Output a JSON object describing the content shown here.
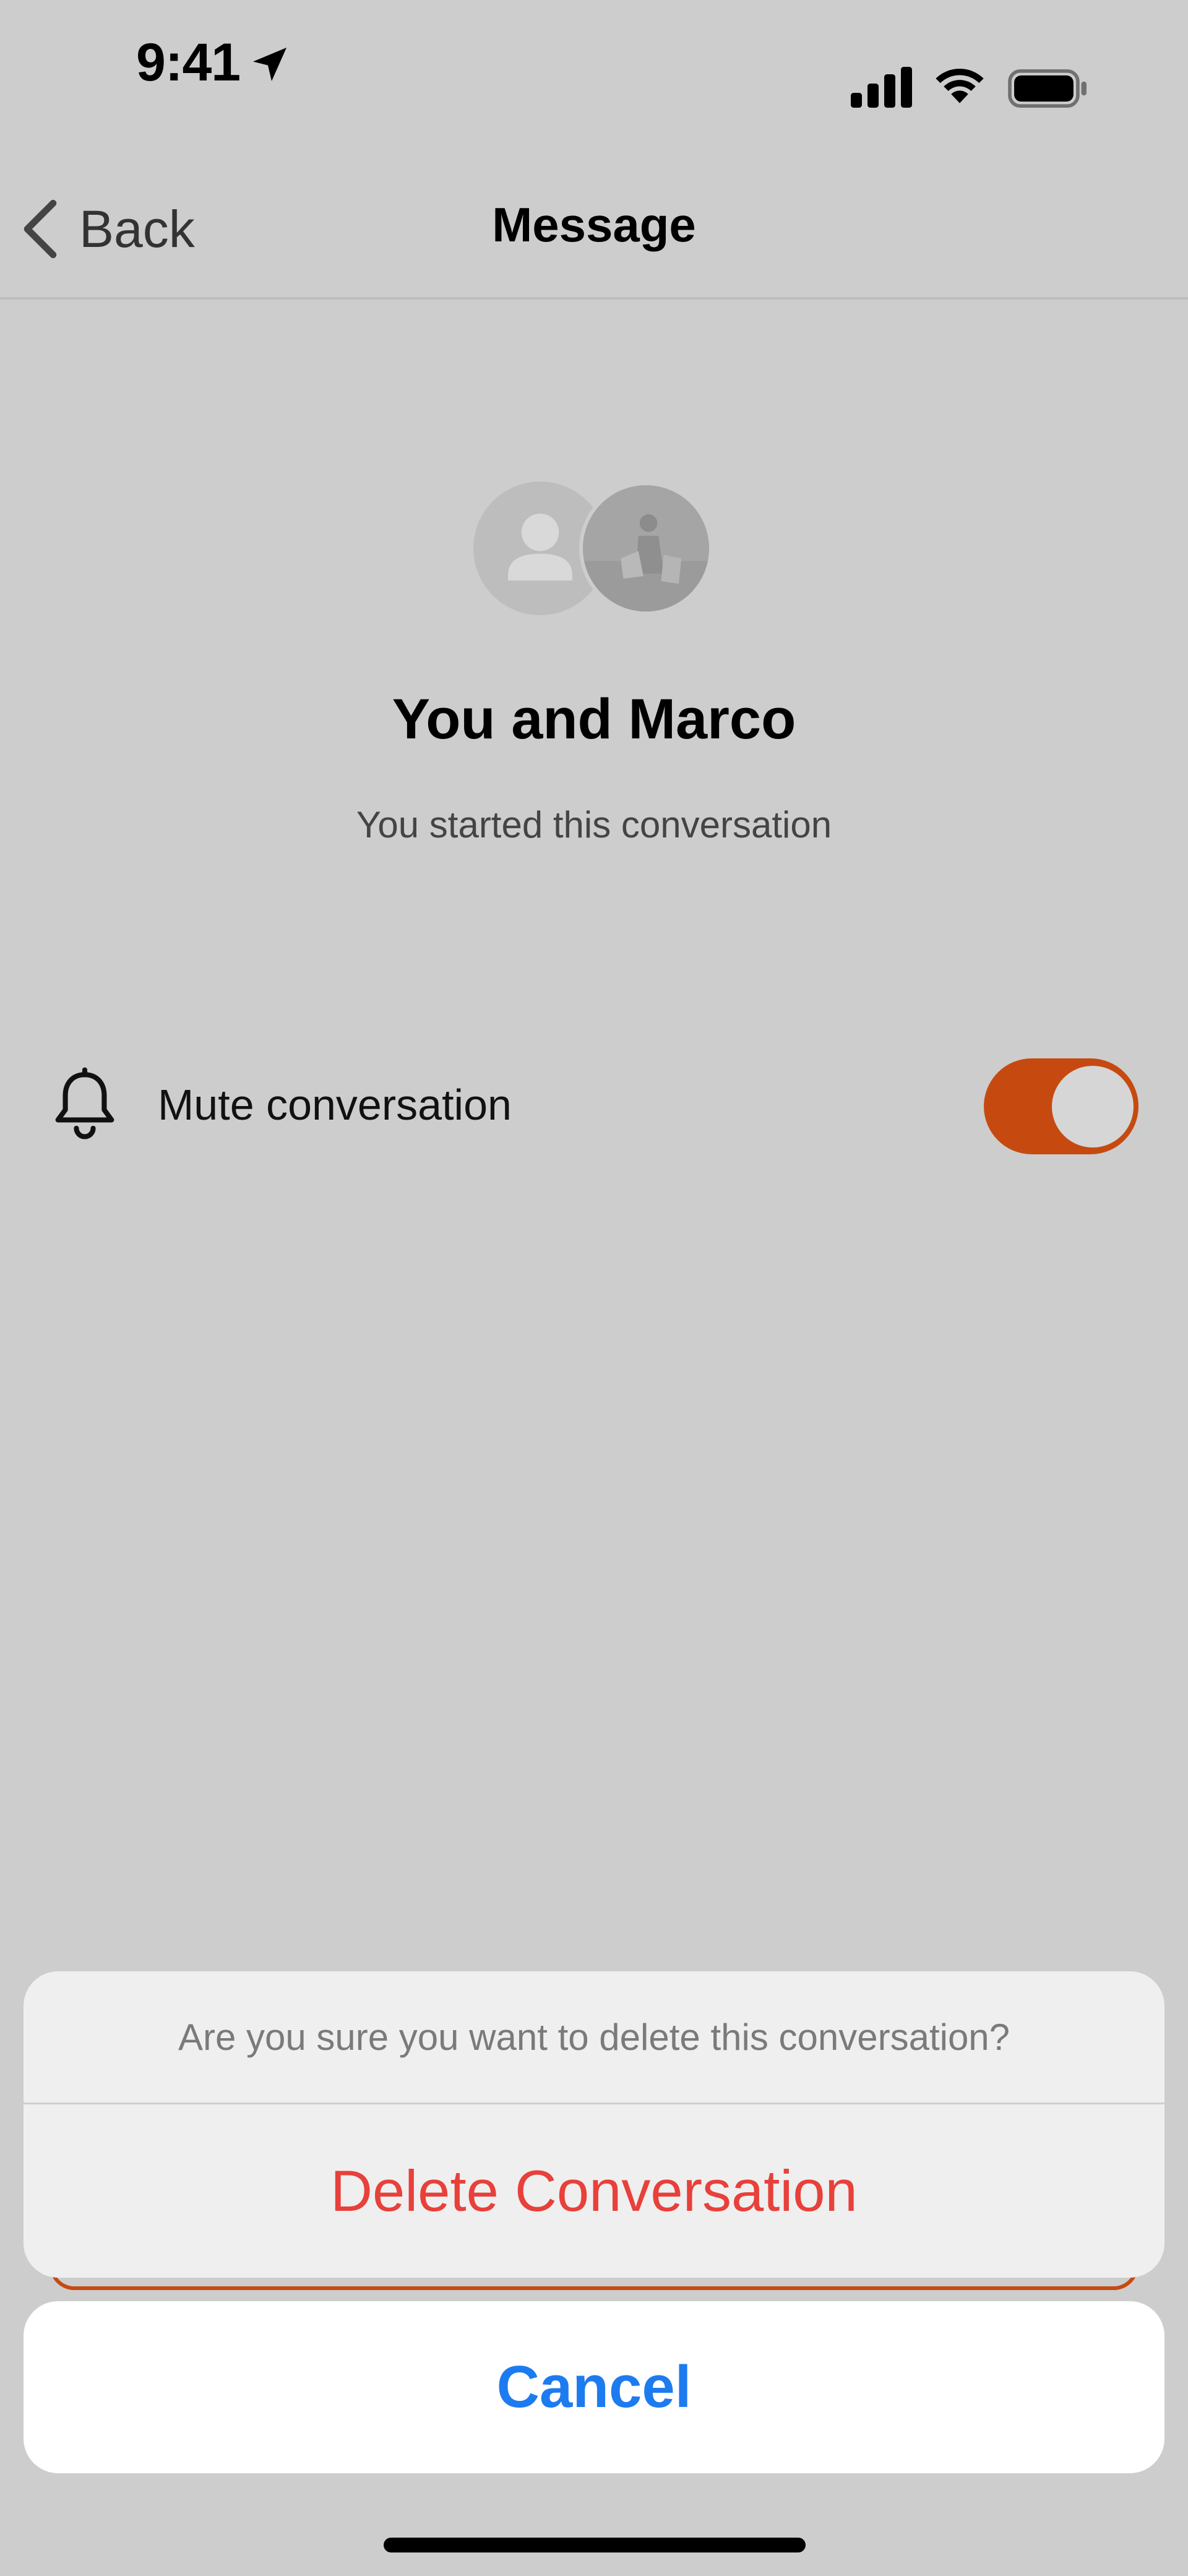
{
  "status_bar": {
    "time": "9:41"
  },
  "nav": {
    "back_label": "Back",
    "title": "Message"
  },
  "conversation": {
    "title": "You and Marco",
    "subtitle": "You started this conversation",
    "participants": [
      "You",
      "Marco"
    ]
  },
  "mute": {
    "label": "Mute conversation",
    "enabled": true
  },
  "action_sheet": {
    "message": "Are you sure you want to delete this conversation?",
    "delete_label": "Delete Conversation",
    "cancel_label": "Cancel"
  },
  "colors": {
    "accent": "#c64a10",
    "destructive": "#e8403a",
    "ios_blue": "#1d7bf0",
    "dim_background": "#cdcdcd"
  },
  "icons": {
    "location": "location-arrow-icon",
    "signal": "cellular-signal-icon",
    "wifi": "wifi-icon",
    "battery": "battery-icon",
    "back": "chevron-left-icon",
    "mute": "bell-icon"
  }
}
